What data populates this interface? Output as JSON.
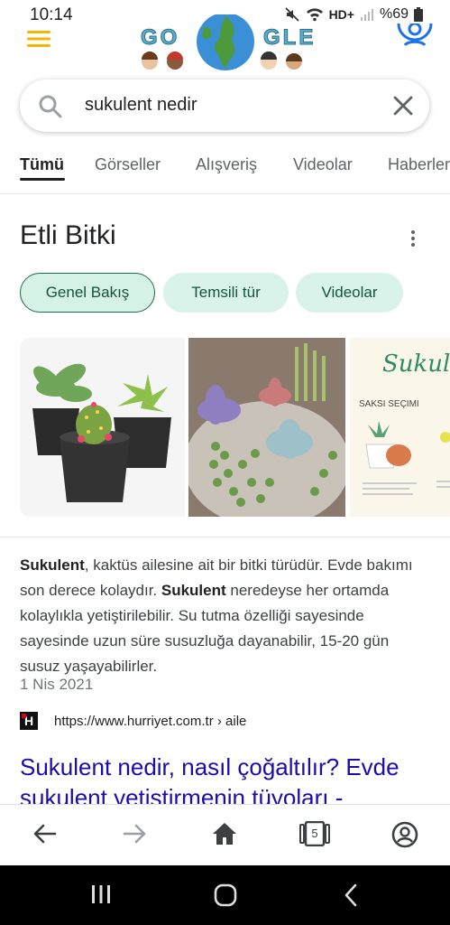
{
  "status_bar": {
    "time": "10:14",
    "network": "HD+",
    "battery": "%69"
  },
  "header": {
    "doodle_letters_left": "GO",
    "doodle_letters_right": "GLE",
    "icons": [
      "menu-icon",
      "account-icon"
    ]
  },
  "search": {
    "query": "sukulent nedir",
    "icons": [
      "search-icon",
      "close-icon"
    ]
  },
  "tabs": [
    {
      "label": "Tümü",
      "active": true
    },
    {
      "label": "Görseller"
    },
    {
      "label": "Alışveriş"
    },
    {
      "label": "Videolar"
    },
    {
      "label": "Haberler"
    }
  ],
  "knowledge_panel": {
    "title": "Etli Bitki",
    "chips": [
      "Genel Bakış",
      "Temsili tür",
      "Videolar"
    ],
    "image_card_text": {
      "title": "Sukulent",
      "label_left": "SAKSI SEÇIMI"
    }
  },
  "snippet": {
    "term": "Sukulent",
    "part1": ", kaktüs ailesine ait bir bitki türüdür. Evde bakımı son derece kolaydır. ",
    "part2": " neredeyse her ortamda kolaylıkla yetiştirilebilir. Su tutma özelliği sayesinde sayesinde uzun süre susuzluğa dayanabilir, 15-20 gün susuz yaşayabilirler.",
    "date": "1 Nis 2021"
  },
  "source": {
    "favicon_letter": "H",
    "url": "https://www.hurriyet.com.tr › aile"
  },
  "result": {
    "title": "Sukulent nedir, nasıl çoğaltılır? Evde sukulent yetiştirmenin tüyoları -"
  },
  "bottom_nav": {
    "tab_count": "5",
    "icons": [
      "back-arrow-icon",
      "forward-arrow-icon",
      "home-icon",
      "tabs-icon",
      "account-icon"
    ]
  },
  "colors": {
    "link": "#1a0dab",
    "chip_bg": "#d9f3ea",
    "chip_text": "#13543c",
    "accent_menu": "#f4b400",
    "account_blue": "#1a73e8"
  }
}
